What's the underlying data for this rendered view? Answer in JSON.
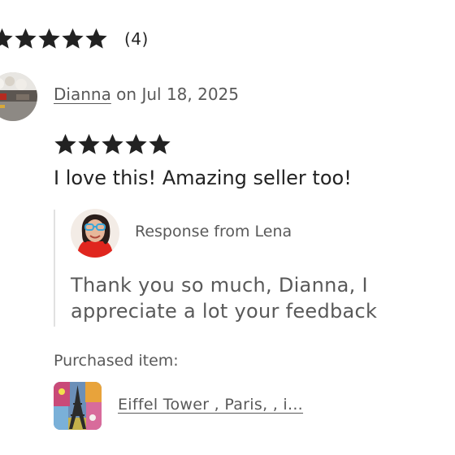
{
  "summary": {
    "stars_filled": 5,
    "count_text": "(4)"
  },
  "review": {
    "reviewer_name": "Dianna",
    "date_text": " on Jul 18, 2025",
    "rating": 5,
    "text": "I love this! Amazing seller too!"
  },
  "response": {
    "label": "Response from Lena",
    "text": "Thank you so much, Dianna, I appreciate a lot your feedback"
  },
  "purchased": {
    "label": "Purchased item:",
    "item_title": "Eiffel Tower , Paris, , i..."
  },
  "colors": {
    "star": "#222222",
    "text_primary": "#222222",
    "text_secondary": "#595959",
    "divider": "#e1e1e1"
  }
}
